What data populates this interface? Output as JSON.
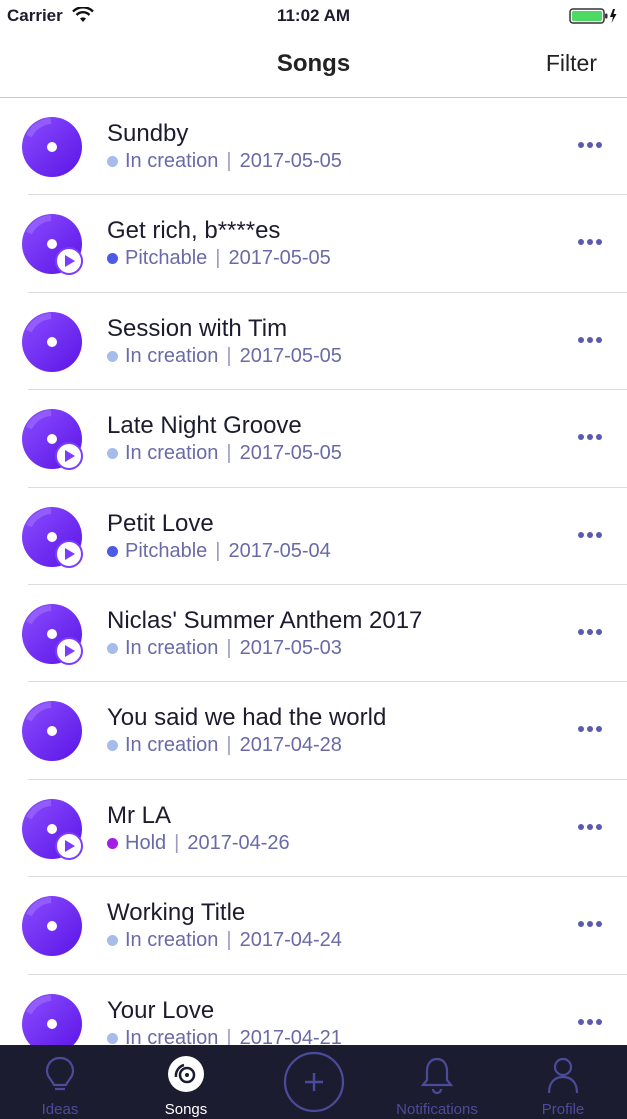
{
  "status_bar": {
    "carrier": "Carrier",
    "time": "11:02 AM"
  },
  "nav": {
    "title": "Songs",
    "filter_label": "Filter"
  },
  "colors": {
    "accent": "#6a2bff",
    "in_creation": "#a6bcea",
    "pitchable": "#4c5ae6",
    "hold": "#a020e8",
    "tab_bar": "#1c1c30"
  },
  "songs": [
    {
      "title": "Sundby",
      "status": "In creation",
      "status_color": "#a6bcea",
      "date": "2017-05-05",
      "has_audio": false
    },
    {
      "title": "Get rich, b****es",
      "status": "Pitchable",
      "status_color": "#4c5ae6",
      "date": "2017-05-05",
      "has_audio": true
    },
    {
      "title": "Session with Tim",
      "status": "In creation",
      "status_color": "#a6bcea",
      "date": "2017-05-05",
      "has_audio": false
    },
    {
      "title": "Late Night Groove",
      "status": "In creation",
      "status_color": "#a6bcea",
      "date": "2017-05-05",
      "has_audio": true
    },
    {
      "title": "Petit Love",
      "status": "Pitchable",
      "status_color": "#4c5ae6",
      "date": "2017-05-04",
      "has_audio": true
    },
    {
      "title": "Niclas' Summer Anthem 2017",
      "status": "In creation",
      "status_color": "#a6bcea",
      "date": "2017-05-03",
      "has_audio": true
    },
    {
      "title": "You said we had the world",
      "status": "In creation",
      "status_color": "#a6bcea",
      "date": "2017-04-28",
      "has_audio": false
    },
    {
      "title": "Mr LA",
      "status": "Hold",
      "status_color": "#a020e8",
      "date": "2017-04-26",
      "has_audio": true
    },
    {
      "title": "Working Title",
      "status": "In creation",
      "status_color": "#a6bcea",
      "date": "2017-04-24",
      "has_audio": false
    },
    {
      "title": "Your Love",
      "status": "In creation",
      "status_color": "#a6bcea",
      "date": "2017-04-21",
      "has_audio": false
    }
  ],
  "tabs": [
    {
      "label": "Ideas",
      "icon": "lightbulb-icon",
      "active": false
    },
    {
      "label": "Songs",
      "icon": "disc-icon",
      "active": true
    },
    {
      "label": "",
      "icon": "plus-icon",
      "active": false
    },
    {
      "label": "Notifications",
      "icon": "bell-icon",
      "active": false
    },
    {
      "label": "Profile",
      "icon": "person-icon",
      "active": false
    }
  ]
}
